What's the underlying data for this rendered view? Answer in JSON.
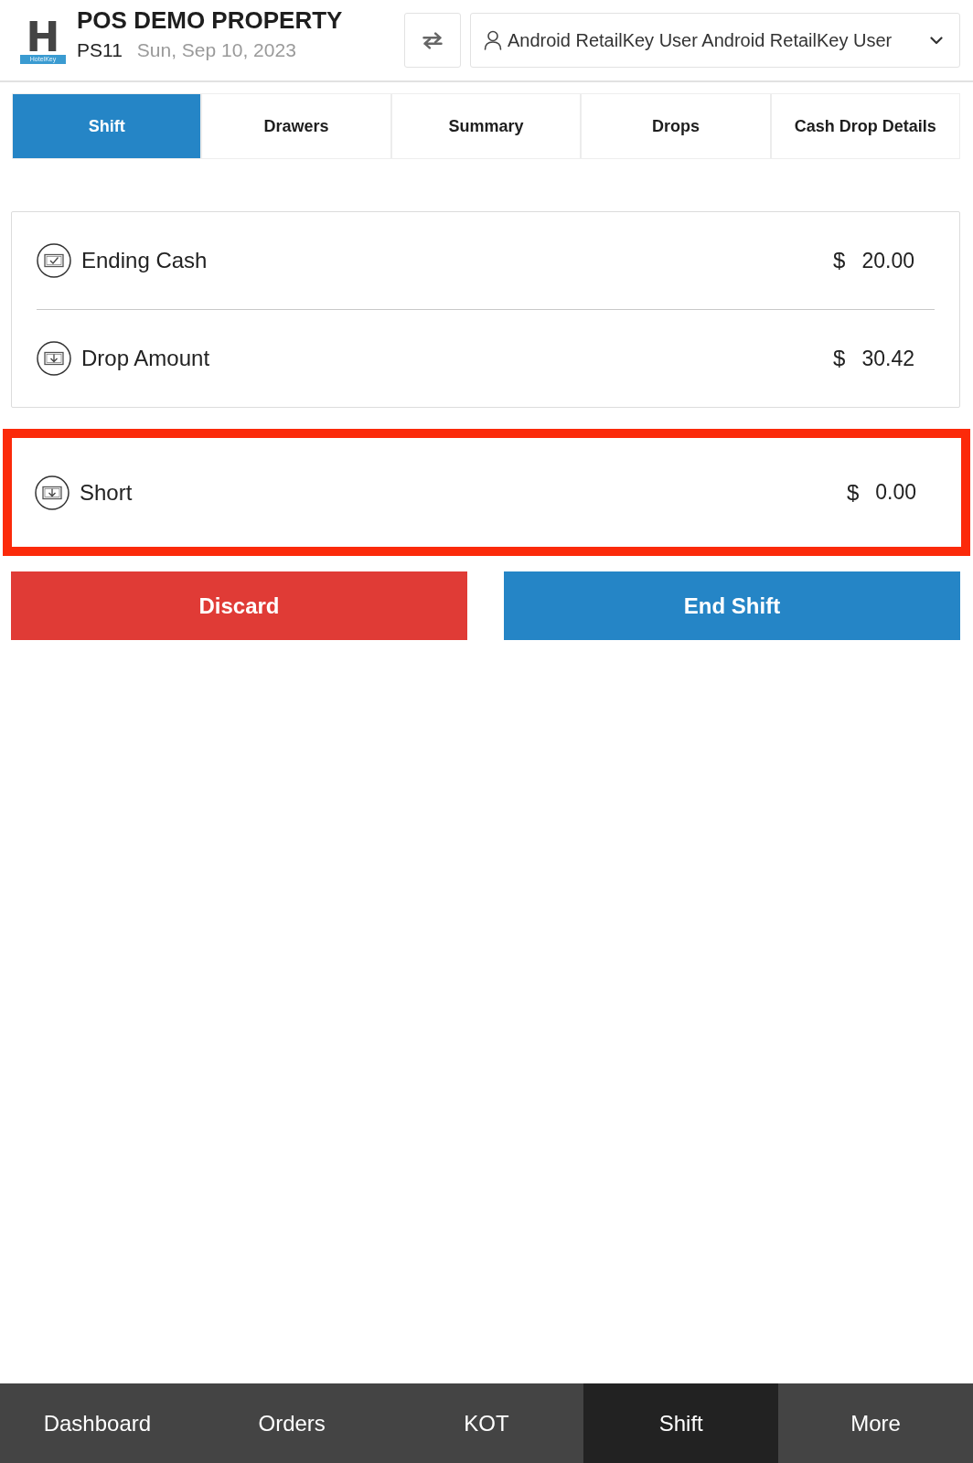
{
  "header": {
    "logo_letter": "H",
    "logo_band": "HotelKey",
    "title": "POS DEMO PROPERTY",
    "station": "PS11",
    "date": "Sun, Sep 10, 2023",
    "user": "Android RetailKey User Android RetailKey User"
  },
  "tabs": [
    {
      "label": "Shift",
      "selected": true
    },
    {
      "label": "Drawers",
      "selected": false
    },
    {
      "label": "Summary",
      "selected": false
    },
    {
      "label": "Drops",
      "selected": false
    },
    {
      "label": "Cash Drop Details",
      "selected": false
    }
  ],
  "totals": [
    {
      "kind": "check",
      "label": "Ending Cash",
      "currency": "$",
      "amount": "20.00"
    },
    {
      "kind": "drop",
      "label": "Drop Amount",
      "currency": "$",
      "amount": "30.42"
    }
  ],
  "short": {
    "kind": "drop",
    "label": "Short",
    "currency": "$",
    "amount": "0.00",
    "highlighted": true
  },
  "buttons": [
    {
      "kind": "danger",
      "label": "Discard"
    },
    {
      "kind": "primary",
      "label": "End Shift"
    }
  ],
  "bottom_nav": [
    {
      "label": "Dashboard",
      "selected": false
    },
    {
      "label": "Orders",
      "selected": false
    },
    {
      "label": "KOT",
      "selected": false
    },
    {
      "label": "Shift",
      "selected": true
    },
    {
      "label": "More",
      "selected": false
    }
  ]
}
